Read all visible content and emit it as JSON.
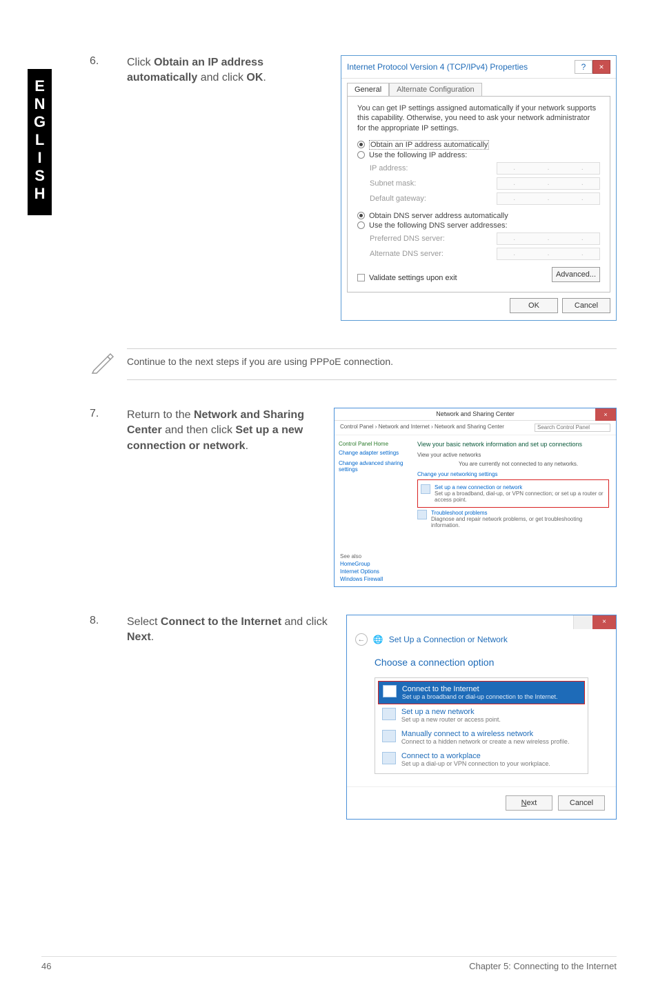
{
  "side_label": "ENGLISH",
  "step6": {
    "num": "6.",
    "pre": "Click ",
    "b1": "Obtain an IP address automatically",
    "mid": " and click ",
    "b2": "OK",
    "post": "."
  },
  "dialog1": {
    "title": "Internet Protocol Version 4 (TCP/IPv4) Properties",
    "help": "?",
    "close": "×",
    "tab_general": "General",
    "tab_alt": "Alternate Configuration",
    "desc": "You can get IP settings assigned automatically if your network supports this capability. Otherwise, you need to ask your network administrator for the appropriate IP settings.",
    "r1": "Obtain an IP address automatically",
    "r2": "Use the following IP address:",
    "f_ip": "IP address:",
    "f_mask": "Subnet mask:",
    "f_gw": "Default gateway:",
    "r3": "Obtain DNS server address automatically",
    "r4": "Use the following DNS server addresses:",
    "f_pdns": "Preferred DNS server:",
    "f_adns": "Alternate DNS server:",
    "chk": "Validate settings upon exit",
    "btn_adv": "Advanced...",
    "btn_ok": "OK",
    "btn_cancel": "Cancel"
  },
  "note": "Continue to the next steps if you are using PPPoE connection.",
  "step7": {
    "num": "7.",
    "pre": "Return to the ",
    "b1": "Network and Sharing Center",
    "mid": " and then click ",
    "b2": "Set up a new connection or network",
    "post": "."
  },
  "shot2": {
    "titlebar": "Network and Sharing Center",
    "crumb": "Control Panel  ›  Network and Internet  ›  Network and Sharing Center",
    "search_ph": "Search Control Panel",
    "side_home": "Control Panel Home",
    "side_l1": "Change adapter settings",
    "side_l2": "Change advanced sharing settings",
    "h1": "View your basic network information and set up connections",
    "sub1": "View your active networks",
    "sub1b": "You are currently not connected to any networks.",
    "linksec": "Change your networking settings",
    "item1_t": "Set up a new connection or network",
    "item1_d": "Set up a broadband, dial-up, or VPN connection; or set up a router or access point.",
    "item2_t": "Troubleshoot problems",
    "item2_d": "Diagnose and repair network problems, or get troubleshooting information.",
    "seealso": "See also",
    "sa1": "HomeGroup",
    "sa2": "Internet Options",
    "sa3": "Windows Firewall"
  },
  "step8": {
    "num": "8.",
    "pre": "Select ",
    "b1": "Connect to the Internet",
    "mid": " and click ",
    "b2": "Next",
    "post": "."
  },
  "shot3": {
    "wiz_title": "Set Up a Connection or Network",
    "q": "Choose a connection option",
    "o1_t": "Connect to the Internet",
    "o1_d": "Set up a broadband or dial-up connection to the Internet.",
    "o2_t": "Set up a new network",
    "o2_d": "Set up a new router or access point.",
    "o3_t": "Manually connect to a wireless network",
    "o3_d": "Connect to a hidden network or create a new wireless profile.",
    "o4_t": "Connect to a workplace",
    "o4_d": "Set up a dial-up or VPN connection to your workplace.",
    "btn_next": "Next",
    "btn_cancel": "Cancel"
  },
  "footer": {
    "page": "46",
    "chapter": "Chapter 5: Connecting to the Internet"
  }
}
